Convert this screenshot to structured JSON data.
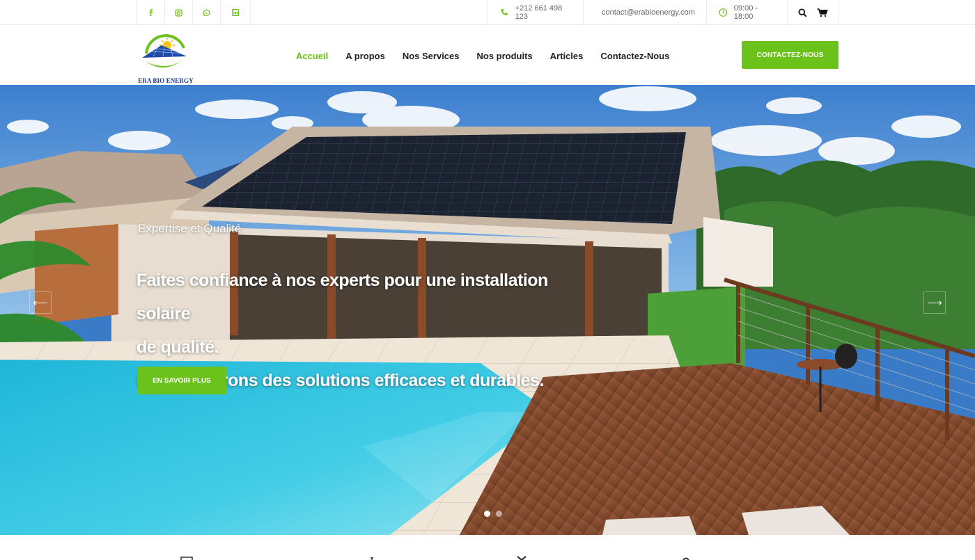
{
  "topbar": {
    "social": [
      {
        "icon": "facebook-icon"
      },
      {
        "icon": "instagram-icon"
      },
      {
        "icon": "whatsapp-icon"
      },
      {
        "icon": "linkedin-icon"
      }
    ],
    "phone": "+212 661 498 123",
    "email": "contact@erabioenergy.com",
    "hours": "09:00 - 18:00"
  },
  "brand": {
    "name": "ERA BIO ENERGY",
    "accent": "#6bc21b"
  },
  "nav": {
    "items": [
      "Accueil",
      "A propos",
      "Nos Services",
      "Nos produits",
      "Articles",
      "Contactez-Nous"
    ],
    "active": "Accueil",
    "cta": "CONTACTEZ-NOUS"
  },
  "hero": {
    "subtitle": "Expertise et Qualité",
    "title_line1": "Faites confiance à nos experts pour une installation solaire",
    "title_line2": "de qualité.",
    "title_line3": "Nous assurons des solutions efficaces et durables.",
    "button": "EN SAVOIR PLUS",
    "prev": "⟵",
    "next": "⟶",
    "slides": 2,
    "active_slide": 1
  }
}
